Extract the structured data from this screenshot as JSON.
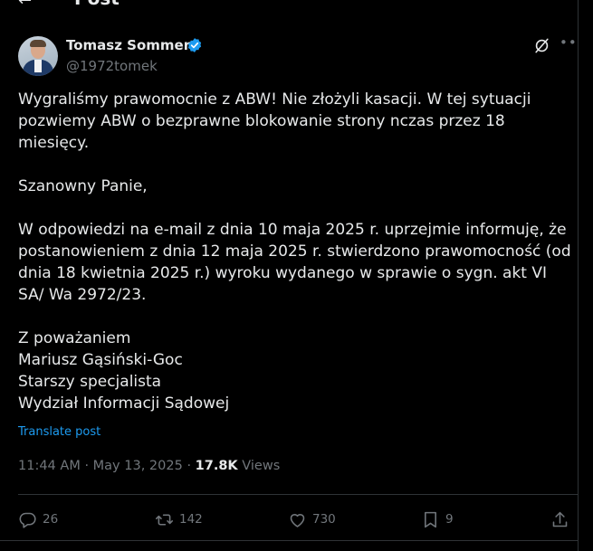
{
  "header": {
    "title": "Post"
  },
  "author": {
    "name": "Tomasz Sommer",
    "handle": "@1972tomek"
  },
  "post": {
    "paragraphs": [
      "Wygraliśmy prawomocnie z ABW! Nie złożyli kasacji. W tej sytuacji pozwiemy ABW o bezprawne blokowanie strony nczas przez 18 miesięcy.",
      "Szanowny Panie,",
      "W odpowiedzi na e-mail z dnia 10 maja 2025 r. uprzejmie informuję,  że postanowieniem z dnia 12 maja 2025 r. stwierdzono prawomocność (od dnia 18 kwietnia 2025 r.) wyroku wydanego w sprawie o sygn. akt VI SA/ Wa 2972/23."
    ],
    "signature": [
      "Z poważaniem",
      "Mariusz Gąsiński-Goc",
      "Starszy specjalista",
      "Wydział Informacji Sądowej"
    ],
    "translate_label": "Translate post",
    "time": "11:44 AM",
    "date": "May 13, 2025",
    "views_count": "17.8K",
    "views_label": "Views"
  },
  "actions": {
    "replies": "26",
    "reposts": "142",
    "likes": "730",
    "bookmarks": "9"
  },
  "colors": {
    "accent": "#1d9bf0",
    "muted": "#71767b",
    "text": "#e7e9ea",
    "background": "#000000"
  },
  "icons": [
    "back-arrow-icon",
    "verified-badge-icon",
    "grok-icon",
    "more-icon",
    "reply-icon",
    "repost-icon",
    "like-icon",
    "bookmark-icon",
    "share-icon"
  ]
}
